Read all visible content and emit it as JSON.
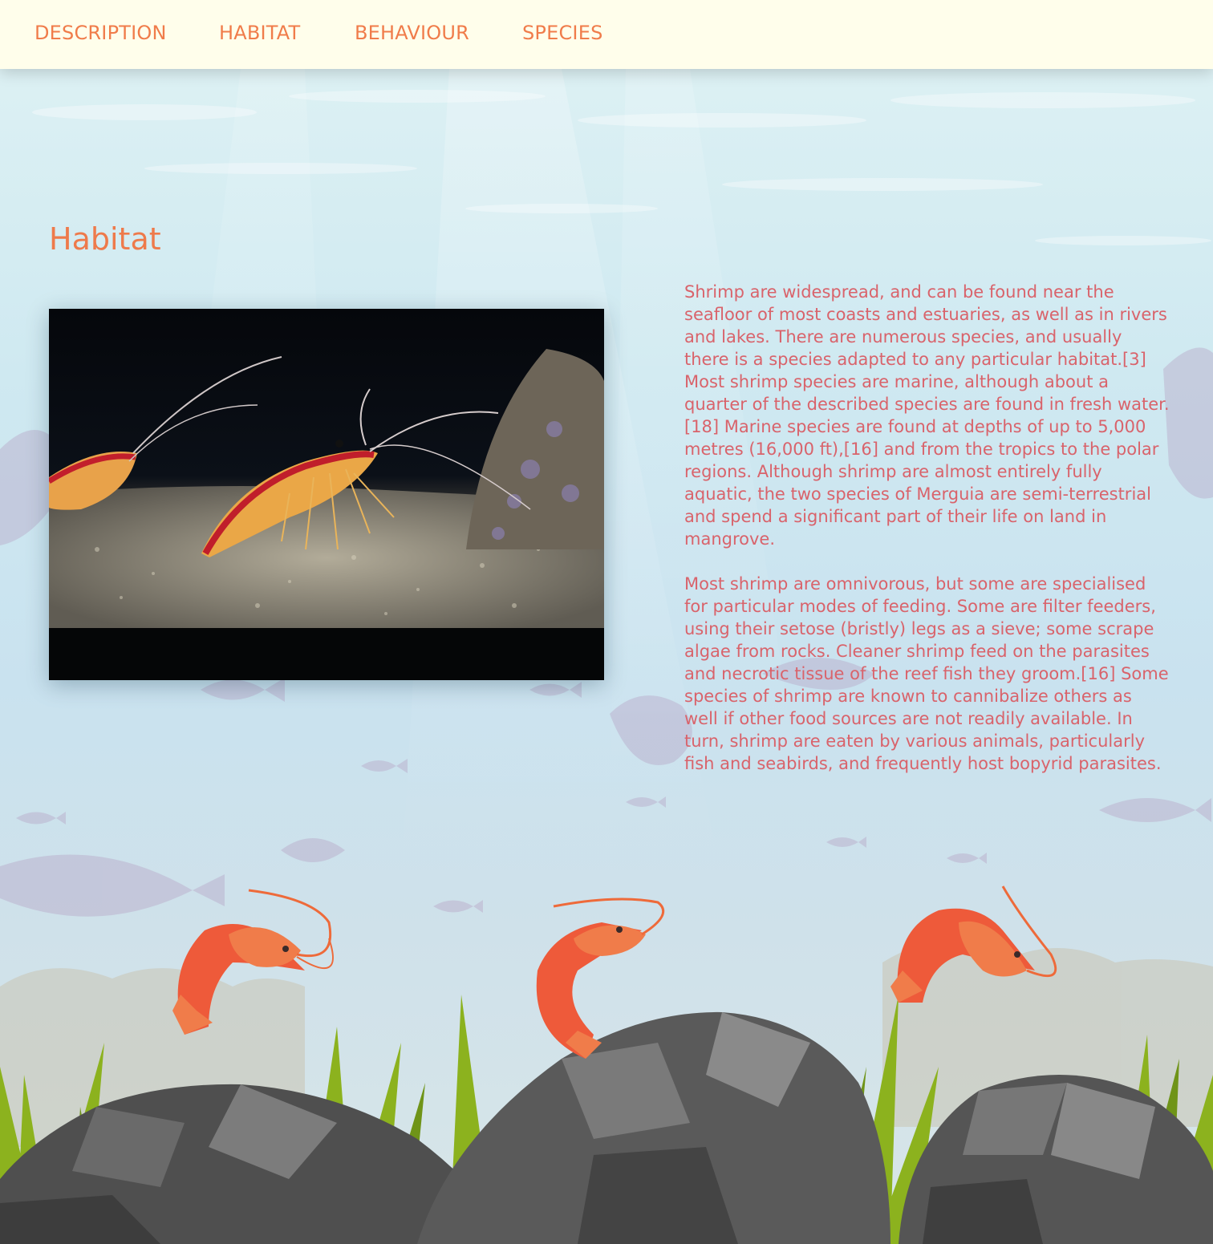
{
  "nav": {
    "items": [
      {
        "label": "DESCRIPTION"
      },
      {
        "label": "HABITAT"
      },
      {
        "label": "BEHAVIOUR"
      },
      {
        "label": "SPECIES"
      }
    ]
  },
  "section": {
    "title": "Habitat",
    "paragraphs": [
      "Shrimp are widespread, and can be found near the seafloor of most coasts and estuaries, as well as in rivers and lakes. There are numerous species, and usually there is a species adapted to any particular habitat.[3] Most shrimp species are marine, although about a quarter of the described species are found in fresh water.[18] Marine species are found at depths of up to 5,000 metres (16,000 ft),[16] and from the tropics to the polar regions. Although shrimp are almost entirely fully aquatic, the two species of Merguia are semi-terrestrial and spend a significant part of their life on land in mangrove.",
      "Most shrimp are omnivorous, but some are specialised for particular modes of feeding. Some are filter feeders, using their setose (bristly) legs as a sieve; some scrape algae from rocks. Cleaner shrimp feed on the parasites and necrotic tissue of the reef fish they groom.[16] Some species of shrimp are known to cannibalize others as well if other food sources are not readily available. In turn, shrimp are eaten by various animals, particularly fish and seabirds, and frequently host bopyrid parasites."
    ]
  },
  "colors": {
    "nav_bg": "#fffeeb",
    "accent": "#f07c4a",
    "body_text": "#d9636b"
  }
}
